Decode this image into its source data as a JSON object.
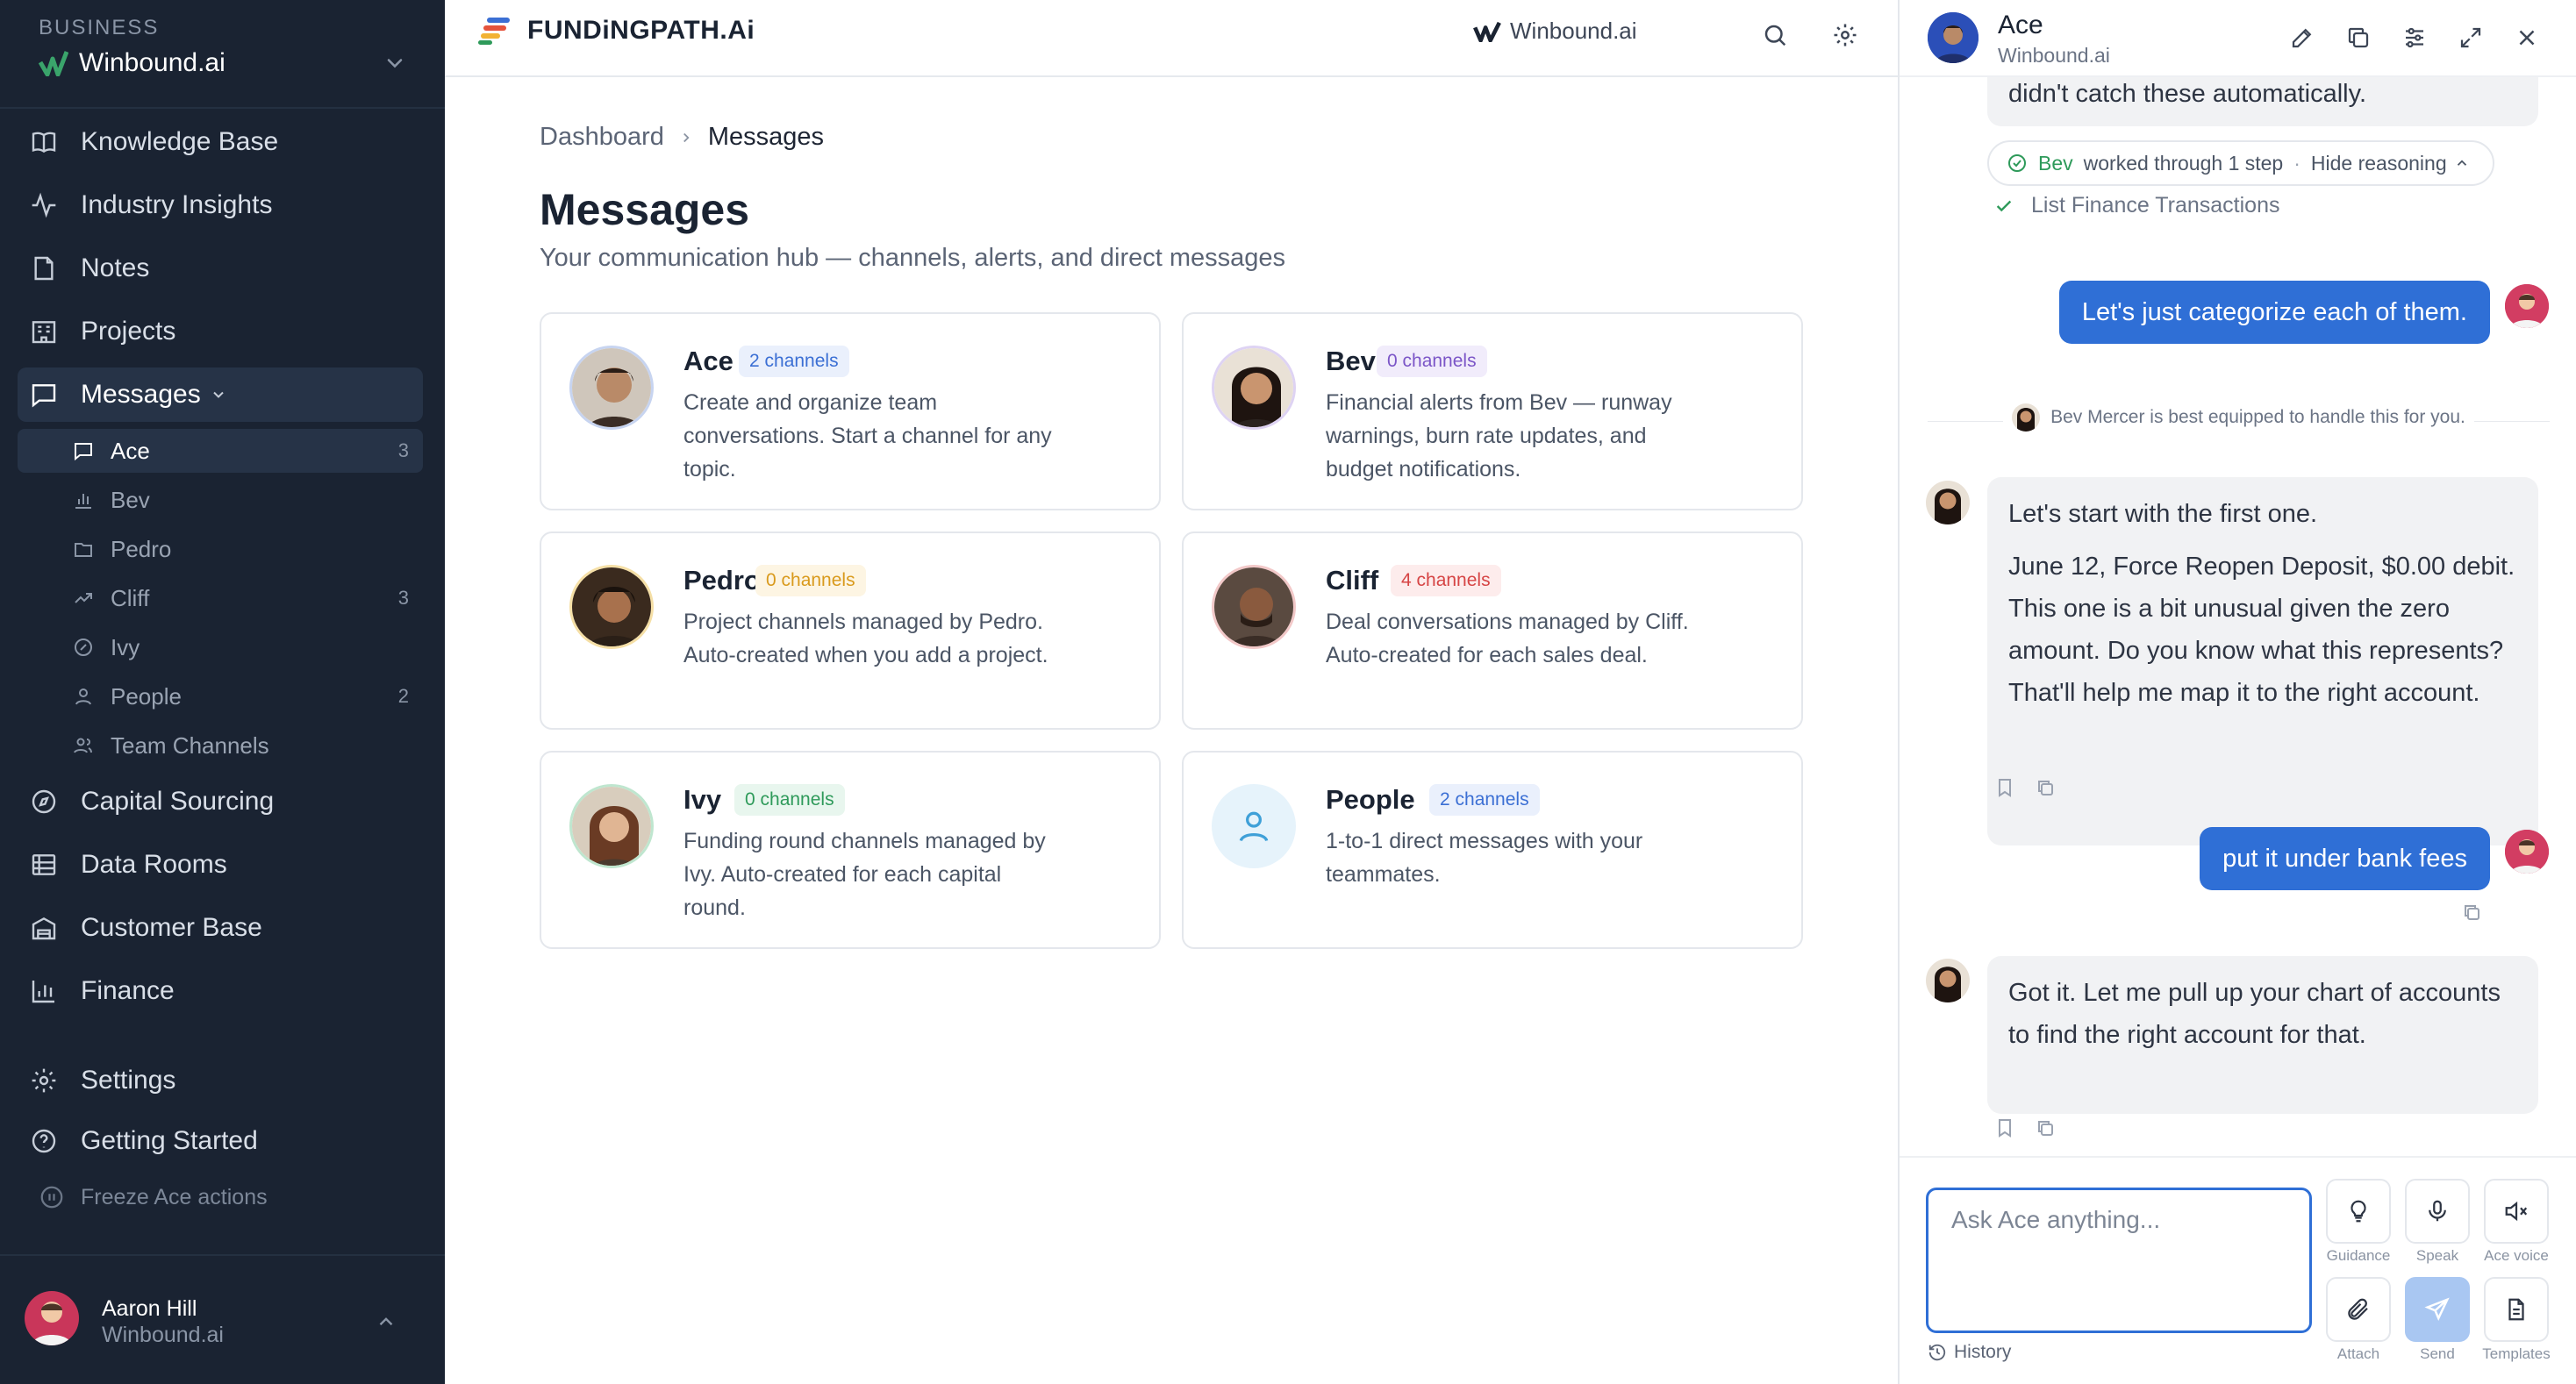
{
  "sidebar": {
    "business_label": "BUSINESS",
    "business_name": "Winbound.ai",
    "nav_top": [
      {
        "label": "Knowledge Base",
        "icon": "book-icon"
      },
      {
        "label": "Industry Insights",
        "icon": "activity-icon"
      },
      {
        "label": "Notes",
        "icon": "note-icon"
      },
      {
        "label": "Projects",
        "icon": "building-icon"
      },
      {
        "label": "Messages",
        "icon": "message-icon"
      }
    ],
    "sub_items": [
      {
        "label": "Ace",
        "count": "3",
        "icon": "chat-icon"
      },
      {
        "label": "Bev",
        "count": "",
        "icon": "bar-chart-icon"
      },
      {
        "label": "Pedro",
        "count": "",
        "icon": "folder-icon"
      },
      {
        "label": "Cliff",
        "count": "3",
        "icon": "trend-icon"
      },
      {
        "label": "Ivy",
        "count": "",
        "icon": "target-icon"
      },
      {
        "label": "People",
        "count": "2",
        "icon": "person-icon"
      },
      {
        "label": "Team Channels",
        "count": "",
        "icon": "people-icon"
      }
    ],
    "nav_bottom": [
      {
        "label": "Capital Sourcing",
        "icon": "compass-icon"
      },
      {
        "label": "Data Rooms",
        "icon": "database-icon"
      },
      {
        "label": "Customer Base",
        "icon": "customers-icon"
      },
      {
        "label": "Finance",
        "icon": "finance-icon"
      },
      {
        "label": "Settings",
        "icon": "gear-icon"
      },
      {
        "label": "Getting Started",
        "icon": "help-icon"
      }
    ],
    "freeze_label": "Freeze Ace actions",
    "user": {
      "name": "Aaron Hill",
      "org": "Winbound.ai"
    }
  },
  "topbar": {
    "brand": "FUNDiNGPATH.Ai",
    "org": "Winbound.ai"
  },
  "main": {
    "breadcrumb": [
      "Dashboard",
      "Messages"
    ],
    "title": "Messages",
    "subtitle": "Your communication hub — channels, alerts, and direct messages",
    "cards": [
      {
        "name": "Ace",
        "badge": "2 channels",
        "badge_color": "#3b6fd4",
        "badge_bg": "#eaf0fc",
        "desc": "Create and organize team conversations. Start a channel for any topic."
      },
      {
        "name": "Bev",
        "badge": "0 channels",
        "badge_color": "#7b55c7",
        "badge_bg": "#f1ecfb",
        "desc": "Financial alerts from Bev — runway warnings, burn rate updates, and budget notifications."
      },
      {
        "name": "Pedro",
        "badge": "0 channels",
        "badge_color": "#d99a1c",
        "badge_bg": "#fdf5e3",
        "desc": "Project channels managed by Pedro. Auto-created when you add a project."
      },
      {
        "name": "Cliff",
        "badge": "4 channels",
        "badge_color": "#d64545",
        "badge_bg": "#fdecec",
        "desc": "Deal conversations managed by Cliff. Auto-created for each sales deal."
      },
      {
        "name": "Ivy",
        "badge": "0 channels",
        "badge_color": "#2e9a5a",
        "badge_bg": "#e8f6ee",
        "desc": "Funding round channels managed by Ivy. Auto-created for each capital round."
      },
      {
        "name": "People",
        "badge": "2 channels",
        "badge_color": "#3b6fd4",
        "badge_bg": "#eaf0fc",
        "desc": "1-to-1 direct messages with your teammates."
      }
    ]
  },
  "chat": {
    "agent_name": "Ace",
    "agent_org": "Winbound.ai",
    "partial_top": "didn't catch these automatically.",
    "reasoning": {
      "agent": "Bev",
      "text": "worked through 1 step",
      "toggle": "Hide reasoning",
      "step": "List Finance Transactions"
    },
    "msg_user_1": "Let's just categorize each of them.",
    "handoff": "Bev Mercer is best equipped to handle this for you.",
    "msg_ai_1_p1": "Let's start with the first one.",
    "msg_ai_1_p2": "June 12, Force Reopen Deposit, $0.00 debit. This one is a bit unusual given the zero amount. Do you know what this represents? That'll help me map it to the right account.",
    "msg_user_2": "put it under bank fees",
    "msg_ai_2": "Got it. Let me pull up your chart of accounts to find the right account for that.",
    "input_placeholder": "Ask Ace anything...",
    "history_label": "History",
    "tools": [
      {
        "label": "Guidance",
        "icon": "lightbulb-icon"
      },
      {
        "label": "Speak",
        "icon": "microphone-icon"
      },
      {
        "label": "Ace voice",
        "icon": "mute-icon"
      },
      {
        "label": "Attach",
        "icon": "paperclip-icon"
      },
      {
        "label": "Send",
        "icon": "send-icon"
      },
      {
        "label": "Templates",
        "icon": "document-icon"
      }
    ]
  },
  "colors": {
    "sidebar_bg": "#1a2332",
    "accent": "#2f6fd6",
    "user_bubble": "#2f6fd6"
  }
}
